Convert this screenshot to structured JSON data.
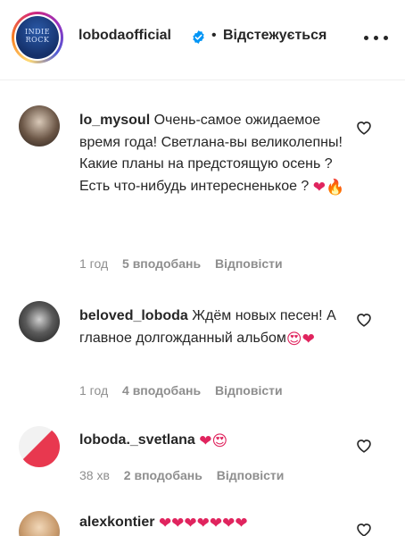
{
  "header": {
    "username": "lobodaofficial",
    "separator": "•",
    "follow_status": "Відстежується",
    "avatar_logo_text": "INDIE ROCK"
  },
  "comments": [
    {
      "username": "lo_mysoul",
      "text": "Очень-самое ожидаемое время года! Светлана-вы великолепны! Какие планы на предстоящую осень ? Есть что-нибудь интересненькое ?",
      "emojis": "❤🔥",
      "time": "1 год",
      "likes": "5 вподобань",
      "reply": "Відповісти"
    },
    {
      "username": "beloved_loboda",
      "text": "Ждём новых песен! А главное долгожданный альбом",
      "emojis": "😍❤",
      "time": "1 год",
      "likes": "4 вподобань",
      "reply": "Відповісти"
    },
    {
      "username": "loboda._svetlana",
      "text": "",
      "emojis": "❤😍",
      "time": "38 хв",
      "likes": "2 вподобань",
      "reply": "Відповісти"
    },
    {
      "username": "alexkontier",
      "text": "",
      "emojis": "❤❤❤❤❤❤❤",
      "time": "",
      "likes": "",
      "reply": ""
    }
  ],
  "colors": {
    "text": "#262626",
    "meta": "#8e8e8e",
    "verified": "#0095f6",
    "heart": "#e0245e"
  },
  "icons": [
    "verified-badge-icon",
    "more-options-icon",
    "like-heart-icon"
  ]
}
